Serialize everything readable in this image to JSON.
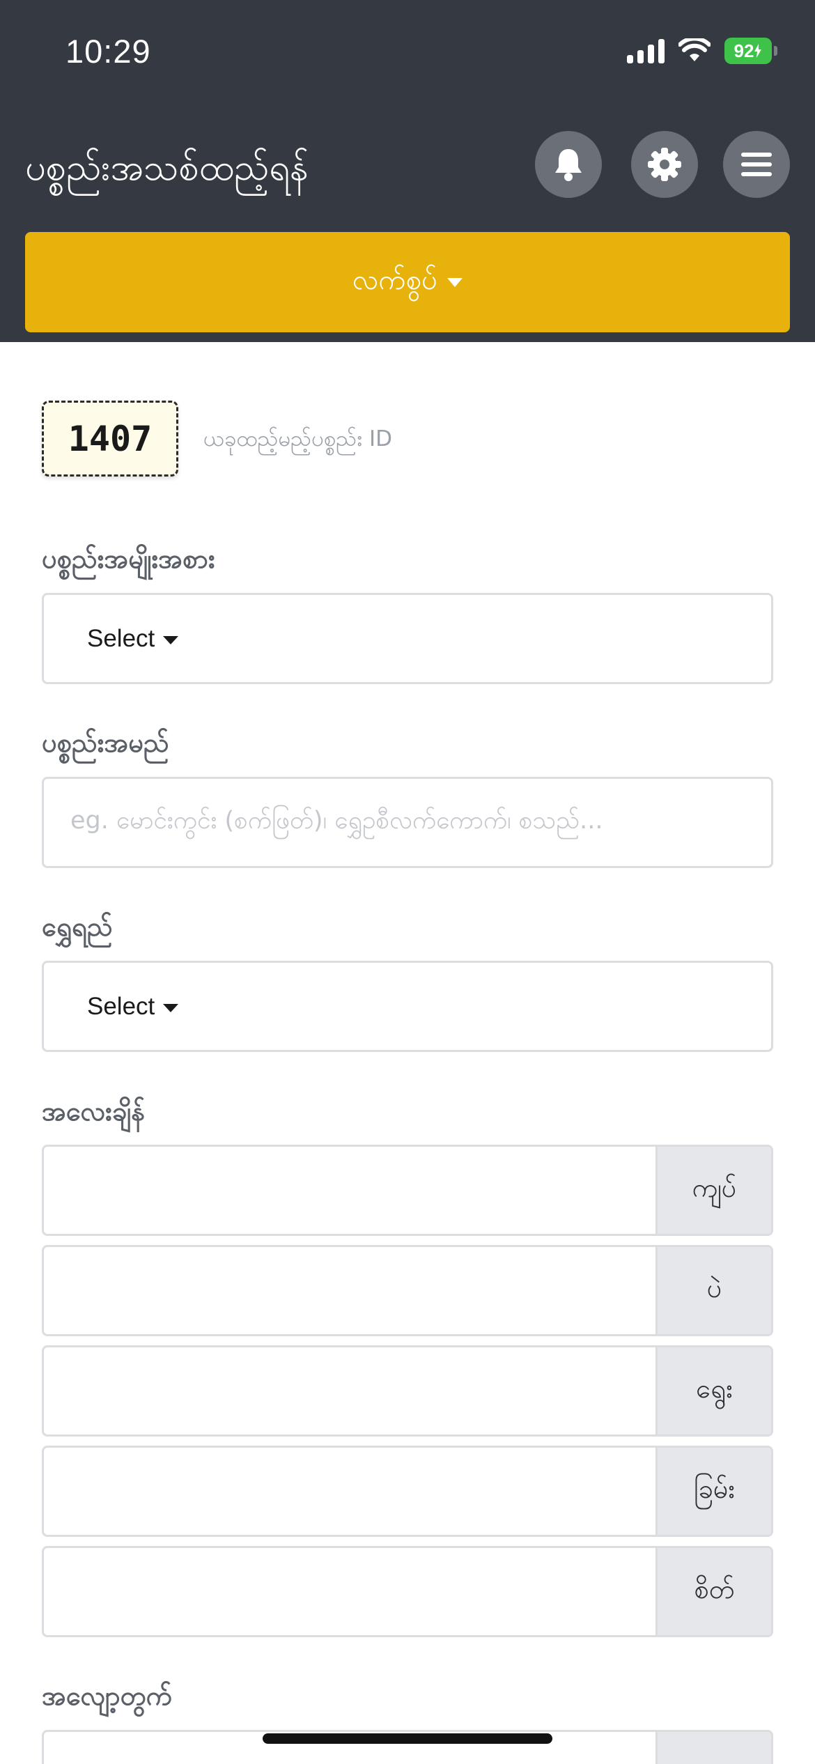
{
  "status_bar": {
    "time": "10:29",
    "battery": "92"
  },
  "header": {
    "title": "ပစ္စည်းအသစ်ထည့်ရန်",
    "notifications_icon": "bell-icon",
    "settings_icon": "gear-icon",
    "menu_icon": "hamburger-menu-icon"
  },
  "action_bar": {
    "label": "လက်စွပ်"
  },
  "item_id": {
    "value": "1407",
    "label": "ယခုထည့်မည့်ပစ္စည်း ID"
  },
  "form": {
    "category": {
      "label": "ပစ္စည်းအမျိုးအစား",
      "value": "Select"
    },
    "name": {
      "label": "ပစ္စည်းအမည်",
      "placeholder": "eg. မောင်းကွင်း (စက်ဖြတ်)၊ ရွှေဥစီလက်ကောက်၊ စသည်..."
    },
    "purity": {
      "label": "ရွှေရည်",
      "value": "Select"
    },
    "weight": {
      "label": "အလေးချိန်",
      "units": [
        "ကျပ်",
        "ပဲ",
        "ရွေး",
        "ခြမ်း",
        "စိတ်"
      ]
    },
    "wastage": {
      "label": "အလျော့တွက်"
    }
  }
}
